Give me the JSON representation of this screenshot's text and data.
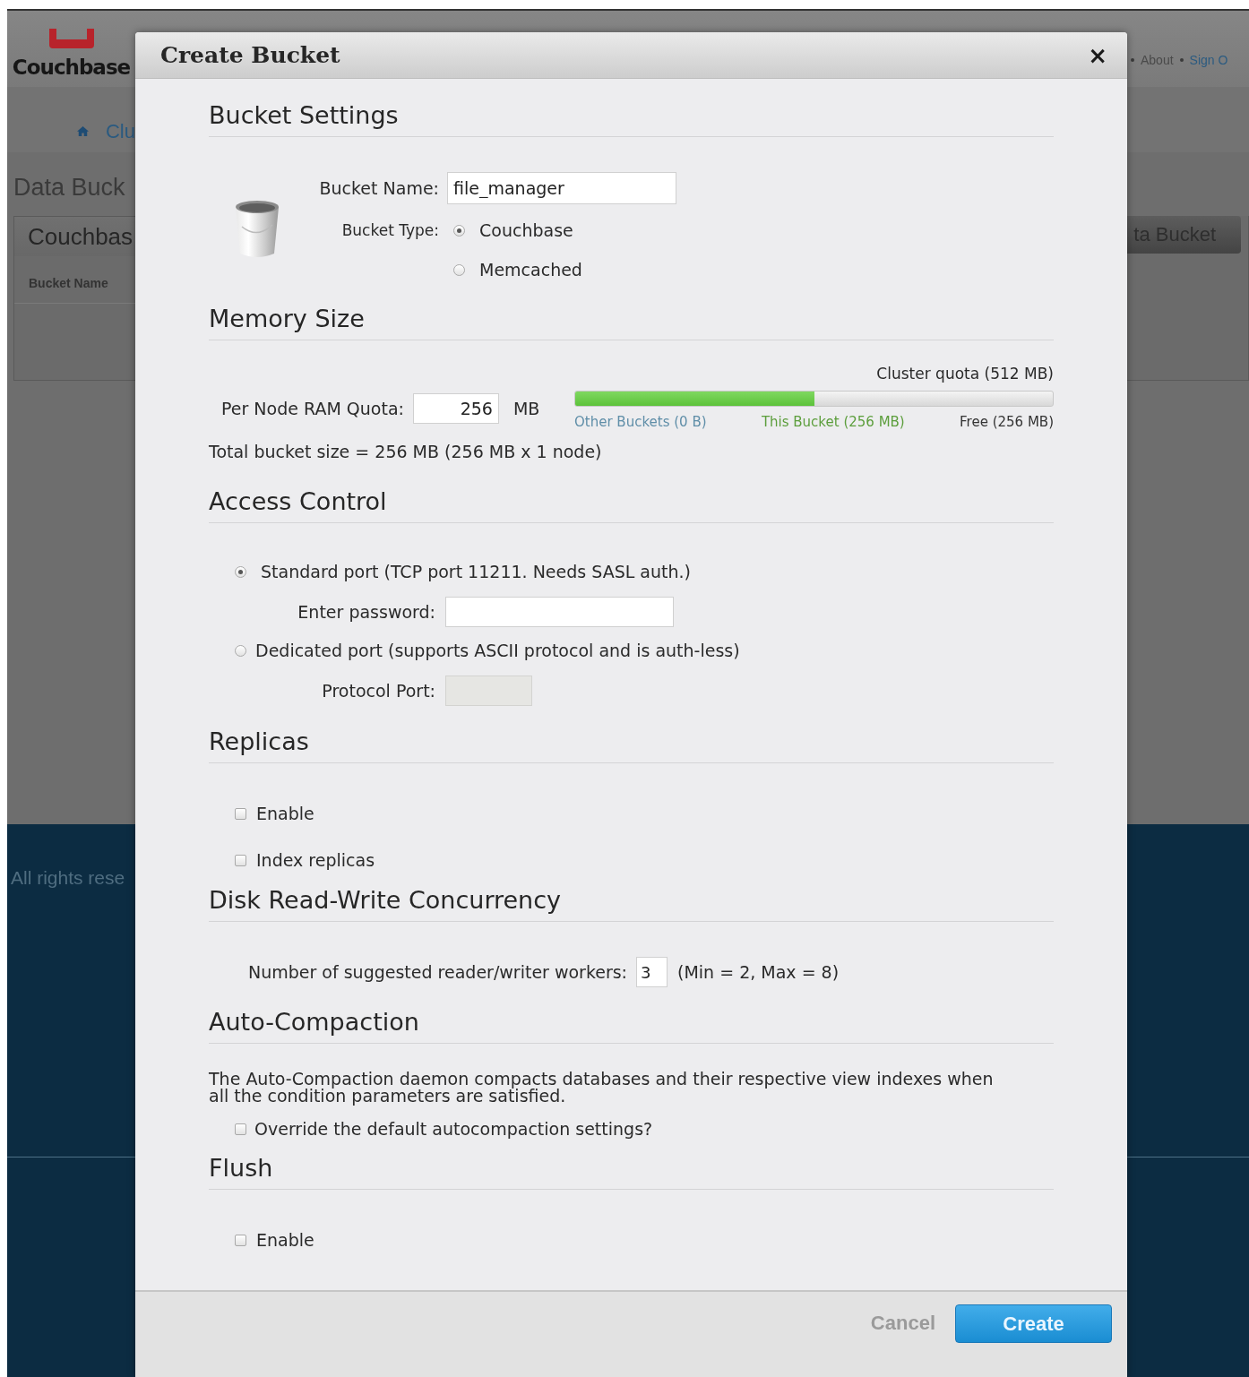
{
  "background": {
    "logo": "Couchbase",
    "top_links": [
      "About",
      "Sign O"
    ],
    "nav_item": "Clu",
    "page_title": "Data Buck",
    "panel_title": "Couchbas",
    "column_1": "Bucket Name",
    "action_button": "ta Bucket",
    "footer": "All rights rese"
  },
  "dialog": {
    "title": "Create Bucket",
    "close": "×",
    "sections": [
      {
        "heading": "Bucket Settings",
        "kind": "bucket",
        "name_label": "Bucket Name:",
        "name_value": "file_manager",
        "type_label": "Bucket Type:",
        "types": [
          {
            "label": "Couchbase",
            "selected": true
          },
          {
            "label": "Memcached",
            "selected": false
          }
        ]
      },
      {
        "heading": "Memory Size",
        "kind": "memory",
        "quota_label": "Cluster quota (512 MB)",
        "ram_label": "Per Node RAM Quota:",
        "ram_value": "256",
        "unit": "MB",
        "level": 0.5,
        "legend": [
          {
            "label": "Other Buckets (0 B)",
            "color": "#5f8ea8"
          },
          {
            "label": "This Bucket (256 MB)",
            "color": "#5c9e3c"
          },
          {
            "label": "Free (256 MB)",
            "color": "#333333"
          }
        ],
        "total": "Total bucket size = 256 MB (256 MB x 1 node)"
      },
      {
        "heading": "Access Control",
        "kind": "access",
        "options": [
          {
            "label": "Standard port (TCP port 11211. Needs SASL auth.)",
            "selected": true,
            "field": {
              "label": "Enter password:",
              "disabled": false
            }
          },
          {
            "label": "Dedicated port (supports ASCII protocol and is auth-less)",
            "selected": false,
            "field": {
              "label": "Protocol Port:",
              "disabled": true
            }
          }
        ]
      },
      {
        "heading": "Replicas",
        "kind": "checks",
        "items": [
          {
            "label": "Enable",
            "checked": false
          },
          {
            "label": "Index replicas",
            "checked": false
          }
        ]
      },
      {
        "heading": "Disk Read-Write Concurrency",
        "kind": "workers",
        "label": "Number of suggested reader/writer workers:",
        "value": "3",
        "hint": "(Min = 2, Max = 8)"
      },
      {
        "heading": "Auto-Compaction",
        "kind": "checks",
        "text": "The Auto-Compaction daemon compacts databases and their respective view indexes when all the condition parameters are satisfied.",
        "items": [
          {
            "label": "Override the default autocompaction settings?",
            "checked": false
          }
        ]
      },
      {
        "heading": "Flush",
        "kind": "checks",
        "items": [
          {
            "label": "Enable",
            "checked": false
          }
        ]
      }
    ],
    "buttons": [
      {
        "label": "Cancel",
        "kind": "link"
      },
      {
        "label": "Create",
        "kind": "primary"
      }
    ]
  }
}
